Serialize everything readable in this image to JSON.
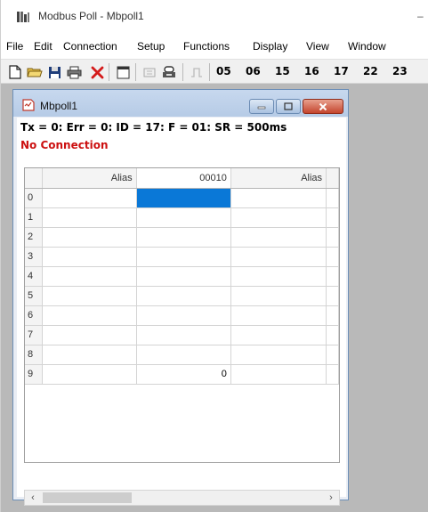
{
  "app": {
    "title": "Modbus Poll - Mbpoll1"
  },
  "menu": [
    "File",
    "Edit",
    "Connection",
    "Setup",
    "Functions",
    "Display",
    "View",
    "Window"
  ],
  "toolbar": {
    "icons": [
      "new-document-icon",
      "open-folder-icon",
      "save-disk-icon",
      "print-icon",
      "delete-x-icon",
      "window-icon",
      "read-write-icon",
      "connect-icon",
      "pulse-icon"
    ],
    "function_codes": [
      "05",
      "06",
      "15",
      "16",
      "17",
      "22",
      "23"
    ]
  },
  "child": {
    "title": "Mbpoll1",
    "status_line": "Tx = 0: Err = 0: ID = 17: F = 01: SR = 500ms",
    "connection_status": "No Connection",
    "grid": {
      "columns": [
        "",
        "Alias",
        "00010",
        "Alias"
      ],
      "rows": [
        {
          "index": "0",
          "alias": "",
          "value": "",
          "alias2": "",
          "selected": true
        },
        {
          "index": "1",
          "alias": "",
          "value": "",
          "alias2": ""
        },
        {
          "index": "2",
          "alias": "",
          "value": "",
          "alias2": ""
        },
        {
          "index": "3",
          "alias": "",
          "value": "",
          "alias2": ""
        },
        {
          "index": "4",
          "alias": "",
          "value": "",
          "alias2": ""
        },
        {
          "index": "5",
          "alias": "",
          "value": "",
          "alias2": ""
        },
        {
          "index": "6",
          "alias": "",
          "value": "",
          "alias2": ""
        },
        {
          "index": "7",
          "alias": "",
          "value": "",
          "alias2": ""
        },
        {
          "index": "8",
          "alias": "",
          "value": "",
          "alias2": ""
        },
        {
          "index": "9",
          "alias": "",
          "value": "0",
          "alias2": ""
        }
      ]
    }
  },
  "colors": {
    "selection": "#0a78d7",
    "error_text": "#cc1010",
    "mdi_background": "#b9b9b9"
  }
}
